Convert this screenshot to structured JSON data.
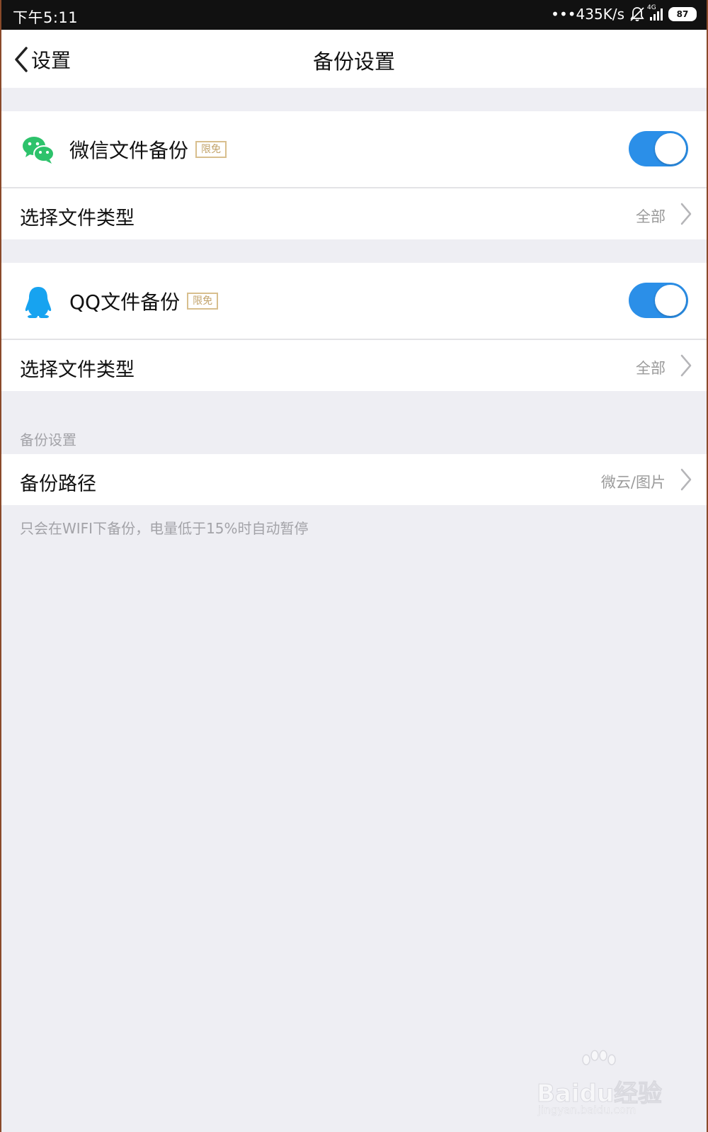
{
  "status_bar": {
    "time": "下午5:11",
    "network_speed": "•••435K/s",
    "network_type": "4G",
    "battery": "87"
  },
  "nav": {
    "back_label": "设置",
    "title": "备份设置"
  },
  "wechat": {
    "label": "微信文件备份",
    "badge": "限免",
    "enabled": true,
    "file_type_label": "选择文件类型",
    "file_type_value": "全部"
  },
  "qq": {
    "label": "QQ文件备份",
    "badge": "限免",
    "enabled": true,
    "file_type_label": "选择文件类型",
    "file_type_value": "全部"
  },
  "backup_settings": {
    "header": "备份设置",
    "path_label": "备份路径",
    "path_value": "微云/图片",
    "note": "只会在WIFI下备份，电量低于15%时自动暂停"
  },
  "watermark": {
    "brand": "Baidu经验",
    "url": "jingyan.baidu.com"
  },
  "colors": {
    "accent": "#2b8fe8",
    "wechat_green": "#2dc26b",
    "qq_blue": "#17a3f0",
    "badge_gold": "#c2a36b",
    "background": "#eeeef3"
  }
}
